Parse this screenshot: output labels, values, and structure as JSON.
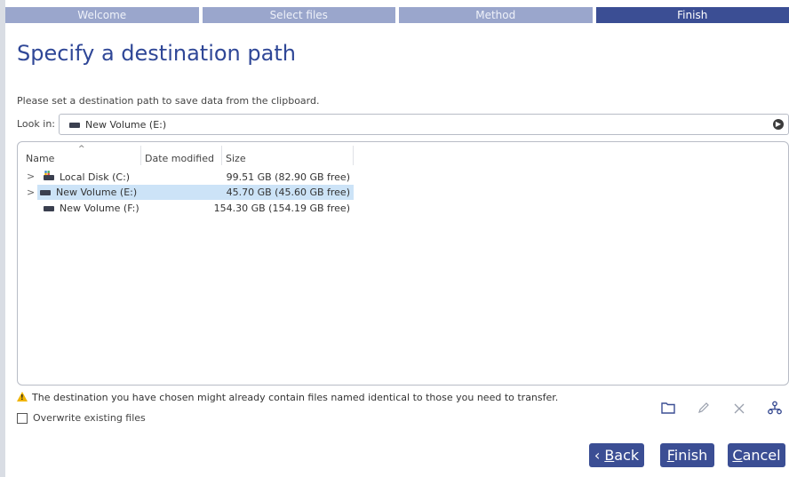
{
  "steps": [
    "Welcome",
    "Select files",
    "Method",
    "Finish"
  ],
  "title": "Specify a destination path",
  "description": "Please set a destination path to save data from the clipboard.",
  "look_in": {
    "label": "Look in:",
    "value": "New Volume (E:)"
  },
  "columns": {
    "name": "Name",
    "date_modified": "Date modified",
    "size": "Size"
  },
  "rows": [
    {
      "name": "Local Disk (C:)",
      "size": "99.51 GB (82.90 GB free)",
      "icon": "system-drive-icon"
    },
    {
      "name": "New Volume (E:)",
      "size": "45.70 GB (45.60 GB free)",
      "icon": "drive-icon",
      "selected": true
    },
    {
      "name": "New Volume (F:)",
      "size": "154.30 GB (154.19 GB free)",
      "icon": "drive-icon"
    }
  ],
  "warning": "The destination you have chosen might already contain files named identical to those you need to transfer.",
  "overwrite_label": "Overwrite existing files",
  "buttons": {
    "back_prefix": "‹ ",
    "back_key": "B",
    "back_rest": "ack",
    "finish_key": "F",
    "finish_rest": "inish",
    "cancel_key": "C",
    "cancel_rest": "ancel"
  },
  "colors": {
    "accent": "#3b4e94",
    "step_inactive": "#9aa6cc",
    "title": "#2f4797",
    "selection": "#cce3f7",
    "warning": "#f0b400"
  }
}
